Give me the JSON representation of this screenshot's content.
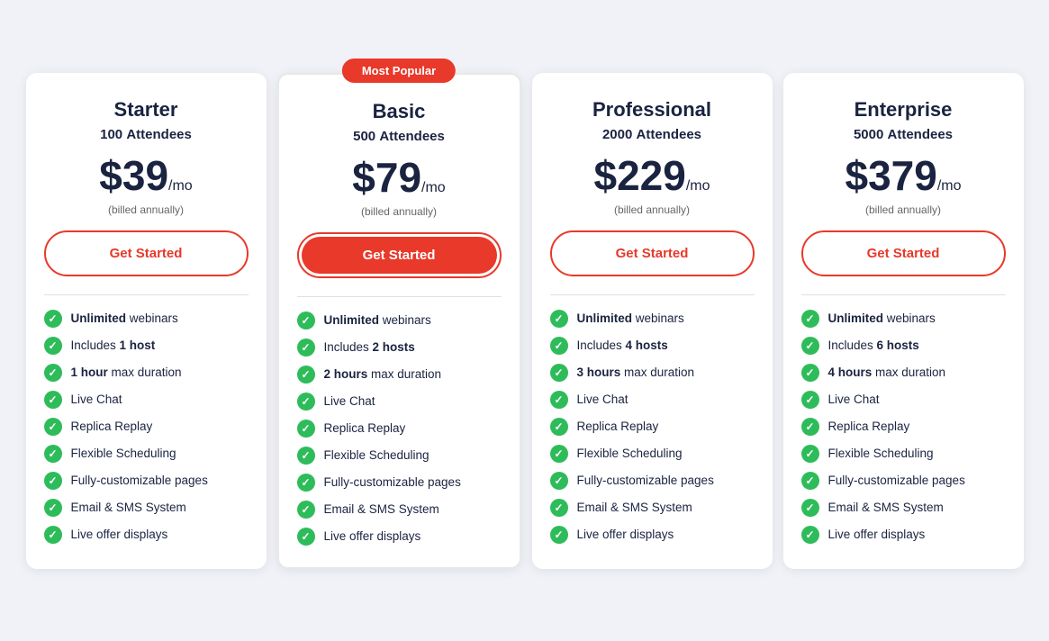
{
  "badge": "Most Popular",
  "plans": [
    {
      "id": "starter",
      "name": "Starter",
      "attendees_count": "100",
      "attendees_label": "Attendees",
      "price": "$39",
      "per": "/mo",
      "billed": "(billed annually)",
      "cta": "Get Started",
      "cta_style": "outline",
      "features": [
        {
          "text": "Unlimited webinars",
          "bold": ""
        },
        {
          "text": " webinars",
          "bold": "Unlimited",
          "full": "Unlimited webinars"
        },
        {
          "text": " host",
          "bold": "Includes 1",
          "full": "Includes 1 host"
        },
        {
          "text": " max duration",
          "bold": "1 hour",
          "full": "1 hour max duration"
        },
        {
          "text": "Live Chat",
          "bold": "",
          "full": "Live Chat"
        },
        {
          "text": "Replica Replay",
          "bold": "",
          "full": "Replica Replay"
        },
        {
          "text": "Flexible Scheduling",
          "bold": "",
          "full": "Flexible Scheduling"
        },
        {
          "text": "Fully-customizable pages",
          "bold": "",
          "full": "Fully-customizable pages"
        },
        {
          "text": "Email & SMS System",
          "bold": "",
          "full": "Email & SMS System"
        },
        {
          "text": "Live offer displays",
          "bold": "",
          "full": "Live offer displays"
        }
      ]
    },
    {
      "id": "basic",
      "name": "Basic",
      "attendees_count": "500",
      "attendees_label": "Attendees",
      "price": "$79",
      "per": "/mo",
      "billed": "(billed annually)",
      "cta": "Get Started",
      "cta_style": "filled",
      "featured": true,
      "features": [
        {
          "full": "Unlimited webinars",
          "bold_part": "Unlimited",
          "rest": " webinars"
        },
        {
          "full": "Includes 2 hosts",
          "bold_part": "Includes 2 hosts",
          "rest": ""
        },
        {
          "full": "2 hours max duration",
          "bold_part": "2 hours",
          "rest": " max duration"
        },
        {
          "full": "Live Chat"
        },
        {
          "full": "Replica Replay"
        },
        {
          "full": "Flexible Scheduling"
        },
        {
          "full": "Fully-customizable pages"
        },
        {
          "full": "Email & SMS System"
        },
        {
          "full": "Live offer displays"
        }
      ]
    },
    {
      "id": "professional",
      "name": "Professional",
      "attendees_count": "2000",
      "attendees_label": "Attendees",
      "price": "$229",
      "per": "/mo",
      "billed": "(billed annually)",
      "cta": "Get Started",
      "cta_style": "outline",
      "features": [
        {
          "full": "Unlimited webinars"
        },
        {
          "full": "Includes 4 hosts"
        },
        {
          "full": "3 hours max duration"
        },
        {
          "full": "Live Chat"
        },
        {
          "full": "Replica Replay"
        },
        {
          "full": "Flexible Scheduling"
        },
        {
          "full": "Fully-customizable pages"
        },
        {
          "full": "Email & SMS System"
        },
        {
          "full": "Live offer displays"
        }
      ]
    },
    {
      "id": "enterprise",
      "name": "Enterprise",
      "attendees_count": "5000",
      "attendees_label": "Attendees",
      "price": "$379",
      "per": "/mo",
      "billed": "(billed annually)",
      "cta": "Get Started",
      "cta_style": "outline",
      "features": [
        {
          "full": "Unlimited webinars"
        },
        {
          "full": "Includes 6 hosts"
        },
        {
          "full": "4 hours max duration"
        },
        {
          "full": "Live Chat"
        },
        {
          "full": "Replica Replay"
        },
        {
          "full": "Flexible Scheduling"
        },
        {
          "full": "Fully-customizable pages"
        },
        {
          "full": "Email & SMS System"
        },
        {
          "full": "Live offer displays"
        }
      ]
    }
  ],
  "features_config": {
    "starter": [
      {
        "html": "<strong>Unlimited</strong> webinars"
      },
      {
        "html": "Includes <strong>1 host</strong>"
      },
      {
        "html": "<strong>1 hour</strong> max duration"
      },
      {
        "html": "Live Chat"
      },
      {
        "html": "Replica Replay"
      },
      {
        "html": "Flexible Scheduling"
      },
      {
        "html": "Fully-customizable pages"
      },
      {
        "html": "Email & SMS System"
      },
      {
        "html": "Live offer displays"
      }
    ],
    "basic": [
      {
        "html": "<strong>Unlimited</strong> webinars"
      },
      {
        "html": "Includes <strong>2 hosts</strong>"
      },
      {
        "html": "<strong>2 hours</strong> max duration"
      },
      {
        "html": "Live Chat"
      },
      {
        "html": "Replica Replay"
      },
      {
        "html": "Flexible Scheduling"
      },
      {
        "html": "Fully-customizable pages"
      },
      {
        "html": "Email & SMS System"
      },
      {
        "html": "Live offer displays"
      }
    ],
    "professional": [
      {
        "html": "<strong>Unlimited</strong> webinars"
      },
      {
        "html": "Includes <strong>4 hosts</strong>"
      },
      {
        "html": "<strong>3 hours</strong> max duration"
      },
      {
        "html": "Live Chat"
      },
      {
        "html": "Replica Replay"
      },
      {
        "html": "Flexible Scheduling"
      },
      {
        "html": "Fully-customizable pages"
      },
      {
        "html": "Email & SMS System"
      },
      {
        "html": "Live offer displays"
      }
    ],
    "enterprise": [
      {
        "html": "<strong>Unlimited</strong> webinars"
      },
      {
        "html": "Includes <strong>6 hosts</strong>"
      },
      {
        "html": "<strong>4 hours</strong> max duration"
      },
      {
        "html": "Live Chat"
      },
      {
        "html": "Replica Replay"
      },
      {
        "html": "Flexible Scheduling"
      },
      {
        "html": "Fully-customizable pages"
      },
      {
        "html": "Email & SMS System"
      },
      {
        "html": "Live offer displays"
      }
    ]
  }
}
